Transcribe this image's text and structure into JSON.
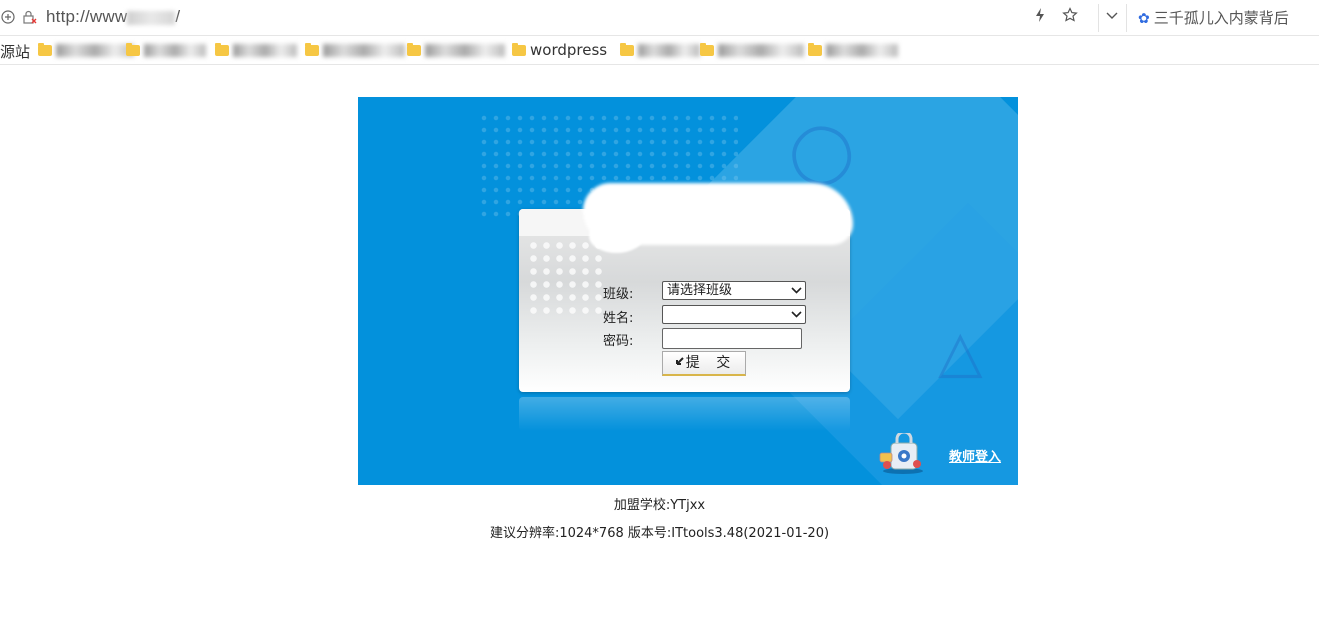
{
  "browser": {
    "url_prefix": "http://www",
    "url_suffix": "/",
    "search_text": "三千孤儿入内蒙背后"
  },
  "bookmarks": [
    {
      "label": "源站",
      "folder": false,
      "blurred": false
    },
    {
      "label": "",
      "folder": true,
      "blurred": true
    },
    {
      "label": "",
      "folder": true,
      "blurred": true
    },
    {
      "label": "",
      "folder": true,
      "blurred": true
    },
    {
      "label": "",
      "folder": true,
      "blurred": true
    },
    {
      "label": "",
      "folder": true,
      "blurred": true
    },
    {
      "label": "wordpress",
      "folder": true,
      "blurred": false
    },
    {
      "label": "",
      "folder": true,
      "blurred": true
    },
    {
      "label": "",
      "folder": true,
      "blurred": true
    },
    {
      "label": "",
      "folder": true,
      "blurred": true
    }
  ],
  "login": {
    "class_label": "班级:",
    "class_selected": "请选择班级",
    "name_label": "姓名:",
    "name_selected": "",
    "password_label": "密码:",
    "password_value": "",
    "submit_label": "提 交",
    "teacher_link": "教师登入"
  },
  "footer": {
    "school": "加盟学校:YTjxx",
    "resolution": "建议分辨率:1024*768 版本号:ITtools3.48(2021-01-20)"
  },
  "colors": {
    "banner_bg": "#0391dc",
    "bookmark_folder": "#f6c744"
  },
  "icons": [
    "add-page-icon",
    "insecure-lock-icon",
    "flash-icon",
    "star-icon",
    "chevron-down-icon",
    "baidu-paw-icon",
    "folder-icon",
    "submit-arrow-icon",
    "teacher-lock-icon"
  ]
}
